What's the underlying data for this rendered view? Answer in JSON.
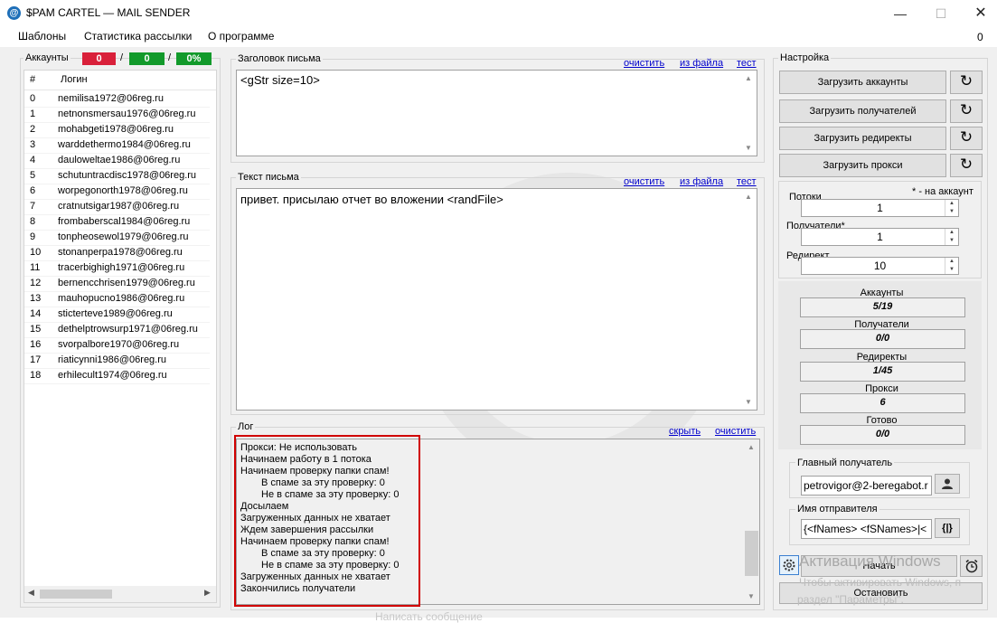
{
  "window": {
    "icon": "@",
    "title": "$PAM CARTEL  — MAIL SENDER",
    "minimize": "—",
    "maximize": "☐",
    "close": "✕"
  },
  "menu": {
    "items": [
      "Шаблоны",
      "Статистика рассылки",
      "О программе"
    ],
    "counter": "0"
  },
  "accounts": {
    "title": "Аккаунты",
    "bad": "0",
    "good": "0",
    "percent": "0%",
    "col_num": "#",
    "col_login": "Логин",
    "rows": [
      {
        "n": "0",
        "login": "nemilisa1972@06reg.ru"
      },
      {
        "n": "1",
        "login": "netnonsmersau1976@06reg.ru"
      },
      {
        "n": "2",
        "login": "mohabgeti1978@06reg.ru"
      },
      {
        "n": "3",
        "login": "warddethermo1984@06reg.ru"
      },
      {
        "n": "4",
        "login": "dauloweltae1986@06reg.ru"
      },
      {
        "n": "5",
        "login": "schutuntracdisc1978@06reg.ru"
      },
      {
        "n": "6",
        "login": "worpegonorth1978@06reg.ru"
      },
      {
        "n": "7",
        "login": "cratnutsigar1987@06reg.ru"
      },
      {
        "n": "8",
        "login": "frombaberscal1984@06reg.ru"
      },
      {
        "n": "9",
        "login": "tonpheosewol1979@06reg.ru"
      },
      {
        "n": "10",
        "login": "stonanperpa1978@06reg.ru"
      },
      {
        "n": "11",
        "login": "tracerbighigh1971@06reg.ru"
      },
      {
        "n": "12",
        "login": "bernencchrisen1979@06reg.ru"
      },
      {
        "n": "13",
        "login": "mauhopucno1986@06reg.ru"
      },
      {
        "n": "14",
        "login": "sticterteve1989@06reg.ru"
      },
      {
        "n": "15",
        "login": "dethelptrowsurp1971@06reg.ru"
      },
      {
        "n": "16",
        "login": "svorpalbore1970@06reg.ru"
      },
      {
        "n": "17",
        "login": "riaticynni1986@06reg.ru"
      },
      {
        "n": "18",
        "login": "erhilecult1974@06reg.ru"
      }
    ]
  },
  "subject": {
    "title": "Заголовок письма",
    "clear": "очистить",
    "from_file": "из файла",
    "test": "тест",
    "value": "<gStr size=10>"
  },
  "body": {
    "title": "Текст письма",
    "clear": "очистить",
    "from_file": "из файла",
    "test": "тест",
    "value": "привет. присылаю отчет во вложении <randFile>"
  },
  "log": {
    "title": "Лог",
    "hide": "скрыть",
    "clear": "очистить",
    "lines": [
      {
        "text": "Прокси: Не использовать",
        "indent": false
      },
      {
        "text": "Начинаем работу в 1 потока",
        "indent": false
      },
      {
        "text": "Начинаем проверку папки спам!",
        "indent": false
      },
      {
        "text": "В спаме за эту проверку: 0",
        "indent": true
      },
      {
        "text": "Не в спаме за эту проверку: 0",
        "indent": true
      },
      {
        "text": "Досылаем",
        "indent": false
      },
      {
        "text": "Загруженных данных не хватает",
        "indent": false
      },
      {
        "text": "Ждем завершения рассылки",
        "indent": false
      },
      {
        "text": "Начинаем проверку папки спам!",
        "indent": false
      },
      {
        "text": "В спаме за эту проверку: 0",
        "indent": true
      },
      {
        "text": "Не в спаме за эту проверку: 0",
        "indent": true
      },
      {
        "text": "Загруженных данных не хватает",
        "indent": false
      },
      {
        "text": "Закончились получатели",
        "indent": false
      }
    ]
  },
  "settings": {
    "title": "Настройка",
    "load_accounts": "Загрузить аккаунты",
    "load_recipients": "Загрузить получателей",
    "load_redirects": "Загрузить редиректы",
    "load_proxies": "Загрузить прокси",
    "refresh_icon": "↻",
    "threads_label": "Потоки",
    "per_account_note": "* - на аккаунт",
    "threads_value": "1",
    "recipients_label": "Получатели*",
    "recipients_value": "1",
    "redirect_label": "Редирект",
    "redirect_value": "10",
    "stats": [
      {
        "label": "Аккаунты",
        "value": "5/19"
      },
      {
        "label": "Получатели",
        "value": "0/0"
      },
      {
        "label": "Редиректы",
        "value": "1/45"
      },
      {
        "label": "Прокси",
        "value": "6"
      },
      {
        "label": "Готово",
        "value": "0/0"
      }
    ],
    "main_recipient_label": "Главный получатель",
    "main_recipient_value": "petrovigor@2-beregabot.r",
    "sender_label": "Имя отправителя",
    "sender_value": "{<fNames> <fSNames>|<",
    "braces_btn": "{|}",
    "start": "Начать",
    "stop": "Остановить"
  },
  "watermark": {
    "title": "Активация Windows",
    "line1": "Чтобы активировать Windows, п",
    "line2": "раздел \"Параметры\".",
    "bottom": "Написать сообщение"
  }
}
